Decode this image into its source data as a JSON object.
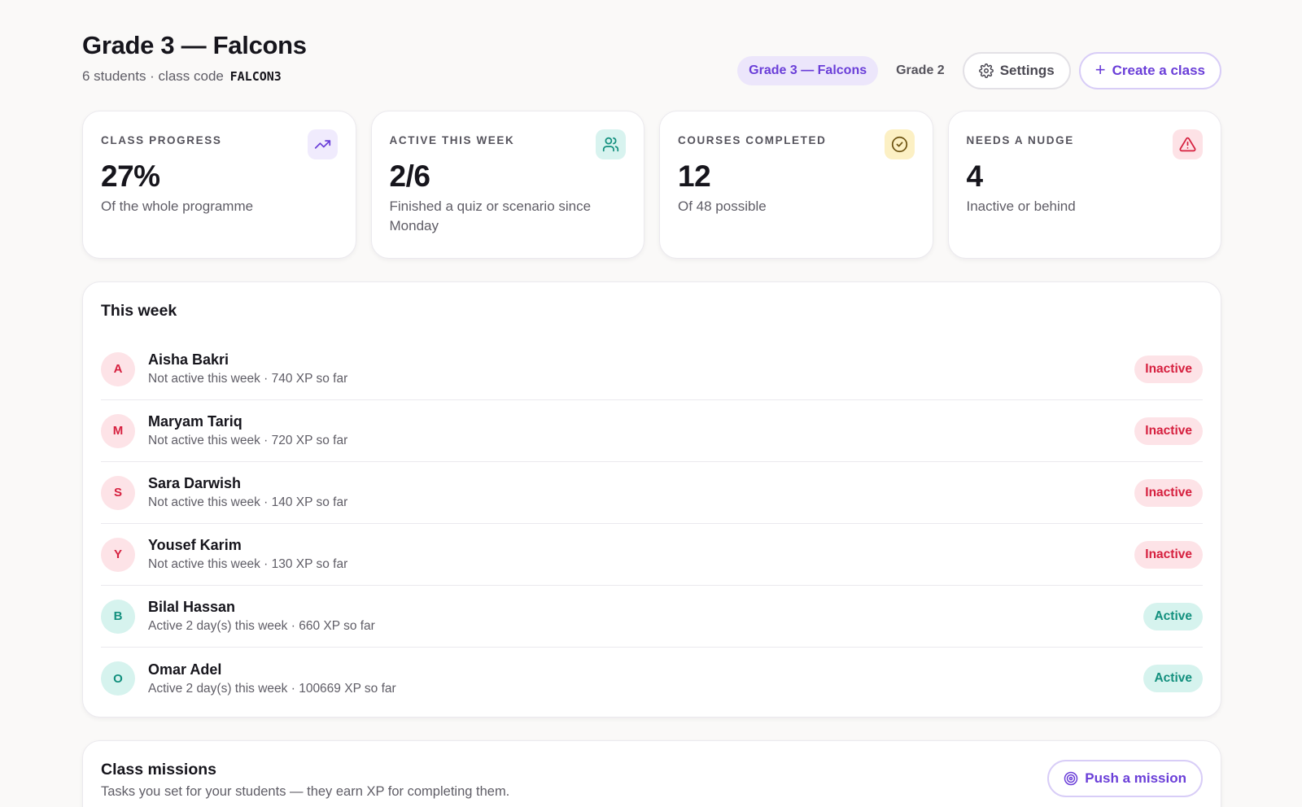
{
  "header": {
    "title": "Grade 3 — Falcons",
    "subtitle_prefix": "6 students · class code",
    "class_code": "FALCON3",
    "tabs": [
      {
        "label": "Grade 3 — Falcons",
        "selected": true
      },
      {
        "label": "Grade 2",
        "selected": false
      }
    ],
    "settings_label": "Settings",
    "create_label": "Create a class"
  },
  "stats": [
    {
      "label": "Class progress",
      "value": "27%",
      "desc": "Of the whole programme",
      "icon": "trending-up-icon"
    },
    {
      "label": "Active this week",
      "value": "2/6",
      "desc": "Finished a quiz or scenario since Monday",
      "icon": "users-icon"
    },
    {
      "label": "Courses completed",
      "value": "12",
      "desc": "Of 48 possible",
      "icon": "check-circle-icon"
    },
    {
      "label": "Needs a nudge",
      "value": "4",
      "desc": "Inactive or behind",
      "icon": "alert-triangle-icon"
    }
  ],
  "this_week": {
    "title": "This week",
    "students": [
      {
        "initial": "A",
        "name": "Aisha Bakri",
        "meta": "Not active this week · 740 XP so far",
        "status": "Inactive"
      },
      {
        "initial": "M",
        "name": "Maryam Tariq",
        "meta": "Not active this week · 720 XP so far",
        "status": "Inactive"
      },
      {
        "initial": "S",
        "name": "Sara Darwish",
        "meta": "Not active this week · 140 XP so far",
        "status": "Inactive"
      },
      {
        "initial": "Y",
        "name": "Yousef Karim",
        "meta": "Not active this week · 130 XP so far",
        "status": "Inactive"
      },
      {
        "initial": "B",
        "name": "Bilal Hassan",
        "meta": "Active 2 day(s) this week · 660 XP so far",
        "status": "Active"
      },
      {
        "initial": "O",
        "name": "Omar Adel",
        "meta": "Active 2 day(s) this week · 100669 XP so far",
        "status": "Active"
      }
    ]
  },
  "missions": {
    "title": "Class missions",
    "subtitle": "Tasks you set for your students — they earn XP for completing them.",
    "push_label": "Push a mission"
  },
  "colors": {
    "accent": "#6a3ed8",
    "inactive": "#d6203f",
    "active": "#13907e"
  }
}
